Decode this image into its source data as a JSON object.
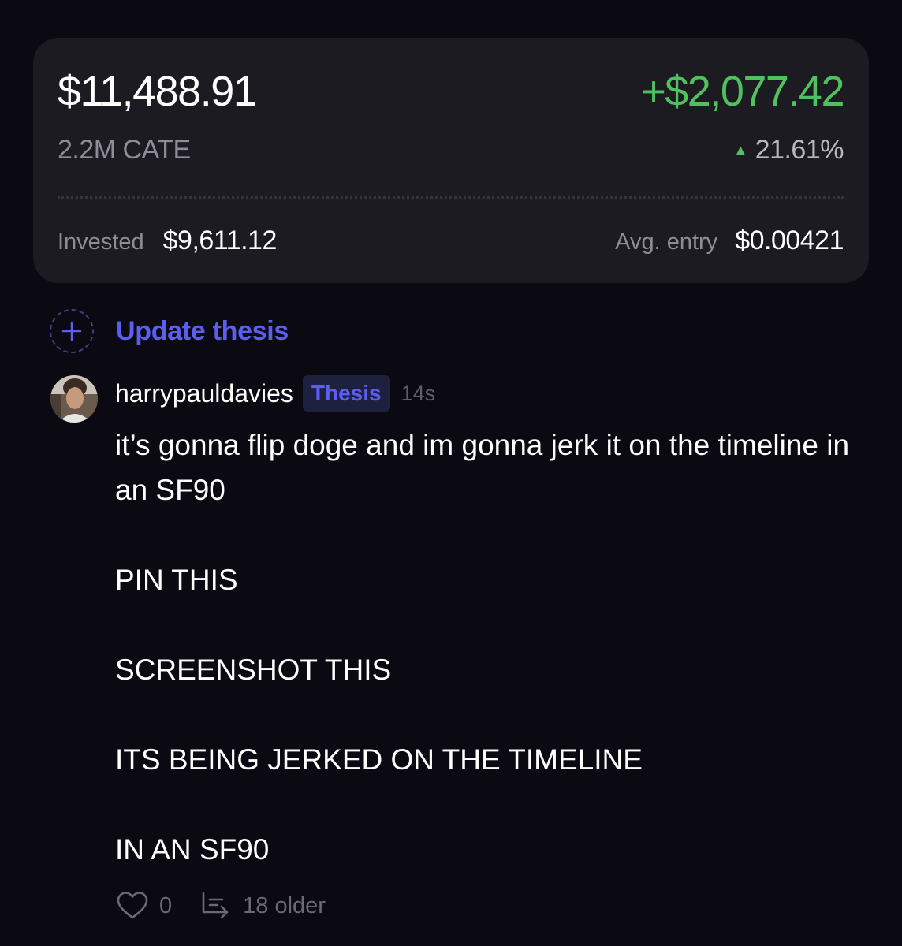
{
  "position": {
    "value": "$11,488.91",
    "pnl": "+$2,077.42",
    "holding": "2.2M CATE",
    "pnl_percent": "21.61%",
    "invested_label": "Invested",
    "invested_value": "$9,611.12",
    "avg_entry_label": "Avg. entry",
    "avg_entry_value": "$0.00421"
  },
  "update_thesis": {
    "label": "Update thesis"
  },
  "post": {
    "username": "harrypauldavies",
    "tag": "Thesis",
    "time_ago": "14s",
    "paragraphs": [
      "it’s gonna flip doge and im gonna jerk it on the timeline in an SF90",
      "PIN THIS",
      "SCREENSHOT THIS",
      "ITS BEING JERKED ON THE TIMELINE",
      "IN AN SF90"
    ],
    "likes": "0",
    "older_label": "18 older"
  },
  "icons": {
    "arrow": "triangle-up-icon",
    "plus": "plus-icon",
    "like": "heart-icon",
    "thread": "thread-reply-icon",
    "avatar": "user-avatar"
  },
  "colors": {
    "background": "#0b0a12",
    "card": "#1c1b22",
    "positive": "#4fc25d",
    "accent": "#5b5ef0",
    "muted": "#8e8c96"
  }
}
